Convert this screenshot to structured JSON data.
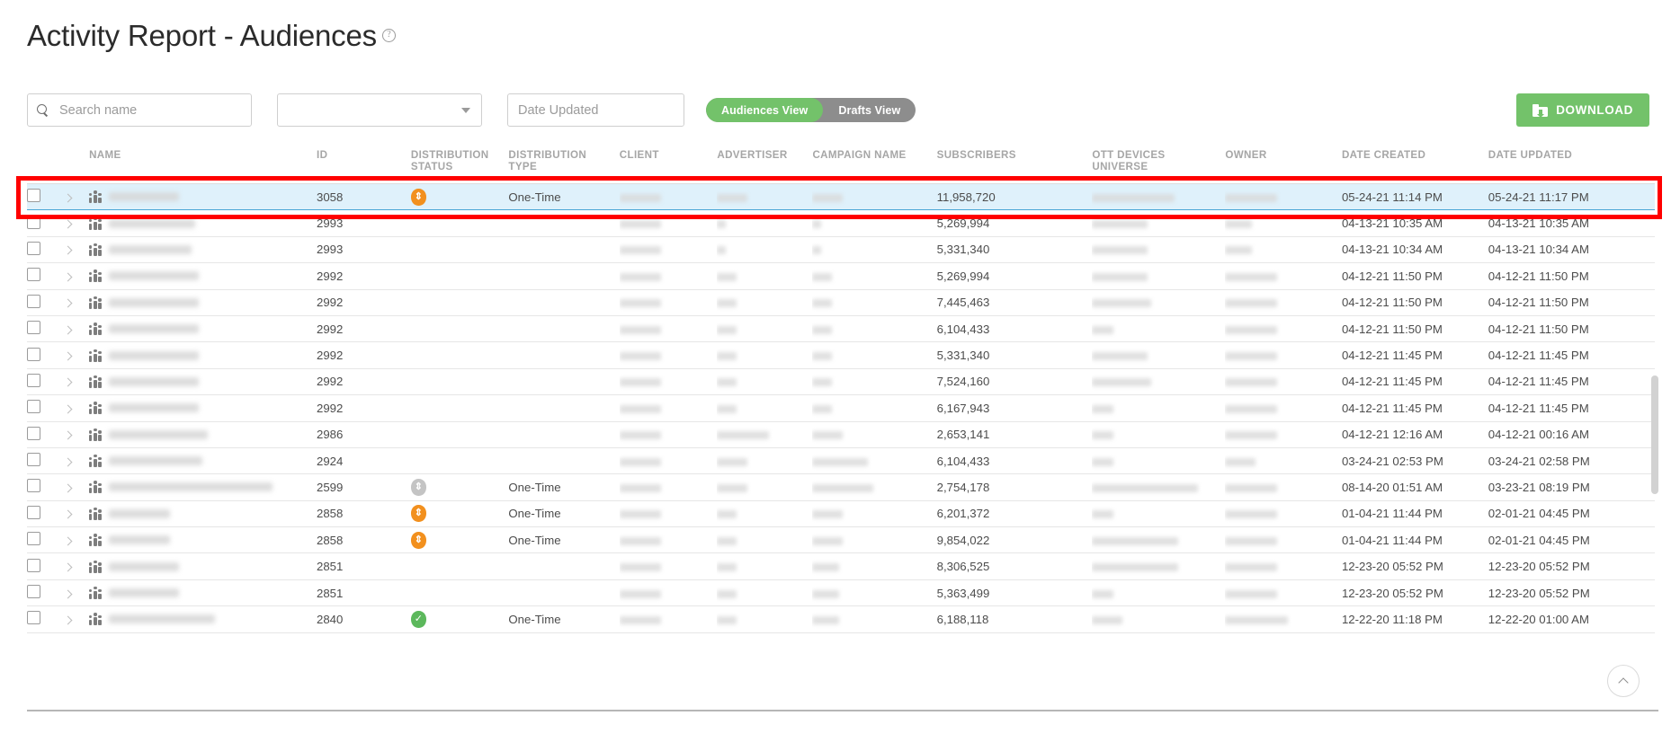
{
  "header": {
    "title": "Activity Report - Audiences",
    "help_icon": "question-mark-icon"
  },
  "toolbar": {
    "search_placeholder": "Search name",
    "search_value": "",
    "filter_select_value": "",
    "date_filter_placeholder": "Date Updated",
    "view_toggle": {
      "active": "Audiences View",
      "options": [
        "Audiences View",
        "Drafts View"
      ]
    },
    "download_label": "DOWNLOAD"
  },
  "table": {
    "columns": [
      {
        "key": "check",
        "label": ""
      },
      {
        "key": "expand",
        "label": ""
      },
      {
        "key": "name",
        "label": "NAME"
      },
      {
        "key": "id",
        "label": "ID"
      },
      {
        "key": "dist_status",
        "label": "DISTRIBUTION STATUS"
      },
      {
        "key": "dist_type",
        "label": "DISTRIBUTION TYPE"
      },
      {
        "key": "client",
        "label": "CLIENT"
      },
      {
        "key": "advertiser",
        "label": "ADVERTISER"
      },
      {
        "key": "campaign",
        "label": "CAMPAIGN NAME"
      },
      {
        "key": "subscribers",
        "label": "SUBSCRIBERS"
      },
      {
        "key": "ott",
        "label": "OTT DEVICES UNIVERSE"
      },
      {
        "key": "owner",
        "label": "OWNER"
      },
      {
        "key": "created",
        "label": "DATE CREATED"
      },
      {
        "key": "updated",
        "label": "DATE UPDATED"
      }
    ],
    "rows": [
      {
        "selected": true,
        "id": "3058",
        "status": "orange",
        "type": "One-Time",
        "subscribers": "11,958,720",
        "created": "05-24-21 11:14 PM",
        "updated": "05-24-21 11:17 PM",
        "name_w": 78,
        "client_w": 46,
        "adv_w": 34,
        "camp_w": 34,
        "ott_w": 92,
        "owner_w": 58
      },
      {
        "selected": false,
        "id": "2993",
        "status": "none",
        "type": "",
        "subscribers": "5,269,994",
        "created": "04-13-21 10:35 AM",
        "updated": "04-13-21 10:35 AM",
        "name_w": 96,
        "client_w": 46,
        "adv_w": 10,
        "camp_w": 10,
        "ott_w": 62,
        "owner_w": 30
      },
      {
        "selected": false,
        "id": "2993",
        "status": "none",
        "type": "",
        "subscribers": "5,331,340",
        "created": "04-13-21 10:34 AM",
        "updated": "04-13-21 10:34 AM",
        "name_w": 92,
        "client_w": 46,
        "adv_w": 10,
        "camp_w": 10,
        "ott_w": 62,
        "owner_w": 30
      },
      {
        "selected": false,
        "id": "2992",
        "status": "none",
        "type": "",
        "subscribers": "5,269,994",
        "created": "04-12-21 11:50 PM",
        "updated": "04-12-21 11:50 PM",
        "name_w": 100,
        "client_w": 46,
        "adv_w": 22,
        "camp_w": 22,
        "ott_w": 62,
        "owner_w": 58
      },
      {
        "selected": false,
        "id": "2992",
        "status": "none",
        "type": "",
        "subscribers": "7,445,463",
        "created": "04-12-21 11:50 PM",
        "updated": "04-12-21 11:50 PM",
        "name_w": 100,
        "client_w": 46,
        "adv_w": 22,
        "camp_w": 22,
        "ott_w": 66,
        "owner_w": 58
      },
      {
        "selected": false,
        "id": "2992",
        "status": "none",
        "type": "",
        "subscribers": "6,104,433",
        "created": "04-12-21 11:50 PM",
        "updated": "04-12-21 11:50 PM",
        "name_w": 100,
        "client_w": 46,
        "adv_w": 22,
        "camp_w": 22,
        "ott_w": 24,
        "owner_w": 58
      },
      {
        "selected": false,
        "id": "2992",
        "status": "none",
        "type": "",
        "subscribers": "5,331,340",
        "created": "04-12-21 11:45 PM",
        "updated": "04-12-21 11:45 PM",
        "name_w": 100,
        "client_w": 46,
        "adv_w": 22,
        "camp_w": 22,
        "ott_w": 62,
        "owner_w": 58
      },
      {
        "selected": false,
        "id": "2992",
        "status": "none",
        "type": "",
        "subscribers": "7,524,160",
        "created": "04-12-21 11:45 PM",
        "updated": "04-12-21 11:45 PM",
        "name_w": 100,
        "client_w": 46,
        "adv_w": 22,
        "camp_w": 22,
        "ott_w": 66,
        "owner_w": 58
      },
      {
        "selected": false,
        "id": "2992",
        "status": "none",
        "type": "",
        "subscribers": "6,167,943",
        "created": "04-12-21 11:45 PM",
        "updated": "04-12-21 11:45 PM",
        "name_w": 100,
        "client_w": 46,
        "adv_w": 22,
        "camp_w": 22,
        "ott_w": 24,
        "owner_w": 58
      },
      {
        "selected": false,
        "id": "2986",
        "status": "none",
        "type": "",
        "subscribers": "2,653,141",
        "created": "04-12-21 12:16 AM",
        "updated": "04-12-21 00:16 AM",
        "name_w": 110,
        "client_w": 46,
        "adv_w": 58,
        "camp_w": 34,
        "ott_w": 24,
        "owner_w": 58
      },
      {
        "selected": false,
        "id": "2924",
        "status": "none",
        "type": "",
        "subscribers": "6,104,433",
        "created": "03-24-21 02:53 PM",
        "updated": "03-24-21 02:58 PM",
        "name_w": 104,
        "client_w": 46,
        "adv_w": 34,
        "camp_w": 62,
        "ott_w": 24,
        "owner_w": 34
      },
      {
        "selected": false,
        "id": "2599",
        "status": "gray",
        "type": "One-Time",
        "subscribers": "2,754,178",
        "created": "08-14-20 01:51 AM",
        "updated": "03-23-21 08:19 PM",
        "name_w": 182,
        "client_w": 46,
        "adv_w": 34,
        "camp_w": 68,
        "ott_w": 118,
        "owner_w": 58
      },
      {
        "selected": false,
        "id": "2858",
        "status": "orange",
        "type": "One-Time",
        "subscribers": "6,201,372",
        "created": "01-04-21 11:44 PM",
        "updated": "02-01-21 04:45 PM",
        "name_w": 68,
        "client_w": 46,
        "adv_w": 22,
        "camp_w": 34,
        "ott_w": 24,
        "owner_w": 58
      },
      {
        "selected": false,
        "id": "2858",
        "status": "orange",
        "type": "One-Time",
        "subscribers": "9,854,022",
        "created": "01-04-21 11:44 PM",
        "updated": "02-01-21 04:45 PM",
        "name_w": 68,
        "client_w": 46,
        "adv_w": 22,
        "camp_w": 34,
        "ott_w": 96,
        "owner_w": 58
      },
      {
        "selected": false,
        "id": "2851",
        "status": "none",
        "type": "",
        "subscribers": "8,306,525",
        "created": "12-23-20 05:52 PM",
        "updated": "12-23-20 05:52 PM",
        "name_w": 78,
        "client_w": 46,
        "adv_w": 22,
        "camp_w": 30,
        "ott_w": 96,
        "owner_w": 58
      },
      {
        "selected": false,
        "id": "2851",
        "status": "none",
        "type": "",
        "subscribers": "5,363,499",
        "created": "12-23-20 05:52 PM",
        "updated": "12-23-20 05:52 PM",
        "name_w": 78,
        "client_w": 46,
        "adv_w": 22,
        "camp_w": 30,
        "ott_w": 24,
        "owner_w": 58
      },
      {
        "selected": false,
        "id": "2840",
        "status": "green",
        "type": "One-Time",
        "subscribers": "6,188,118",
        "created": "12-22-20 11:18 PM",
        "updated": "12-22-20 01:00 AM",
        "name_w": 118,
        "client_w": 46,
        "adv_w": 22,
        "camp_w": 30,
        "ott_w": 34,
        "owner_w": 70
      }
    ]
  },
  "controls": {
    "scroll_top_icon": "chevron-up-icon",
    "scrollbar": "vertical-scrollbar"
  },
  "colors": {
    "accent_green": "#73c26a",
    "toggle_inactive": "#8d8d8d",
    "selected_row_bg": "#dff1fb",
    "selected_row_border": "#49a5d6",
    "status_orange": "#f2901e",
    "status_gray": "#c4c4c4",
    "status_green": "#5cb85c",
    "highlight_box": "#ff0000"
  }
}
